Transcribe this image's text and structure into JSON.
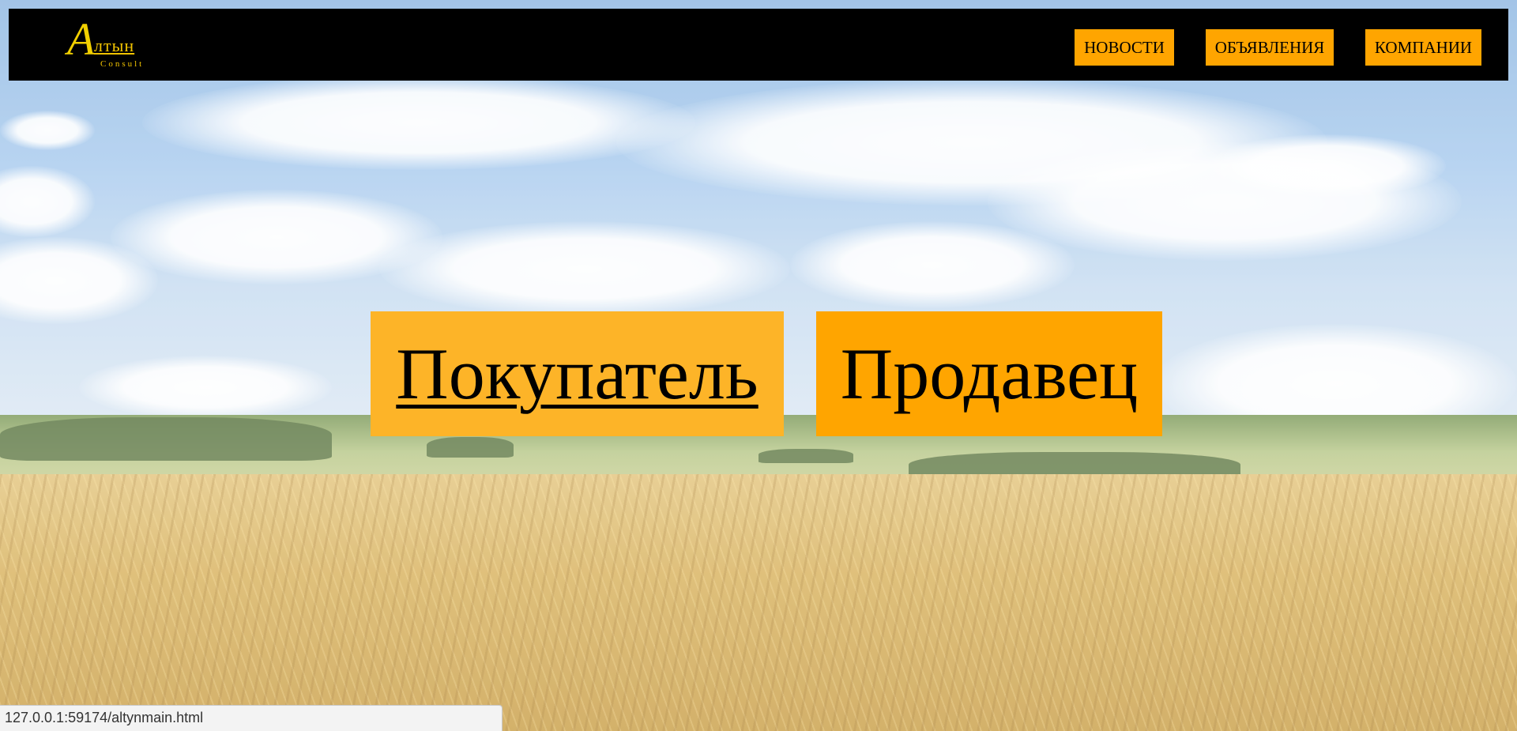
{
  "logo": {
    "mark": "А",
    "word": "лтын",
    "sub": "Consult"
  },
  "nav": {
    "items": [
      {
        "label": "НОВОСТИ"
      },
      {
        "label": "ОБЪЯВЛЕНИЯ"
      },
      {
        "label": "КОМПАНИИ"
      }
    ]
  },
  "main": {
    "buyer_label": "Покупатель",
    "seller_label": "Продавец"
  },
  "status_bar": {
    "url": "127.0.0.1:59174/altynmain.html"
  },
  "colors": {
    "navbar": "#000000",
    "accent": "#ffa500",
    "buyer_button": "#fdb428",
    "logo": "#f2c400"
  }
}
